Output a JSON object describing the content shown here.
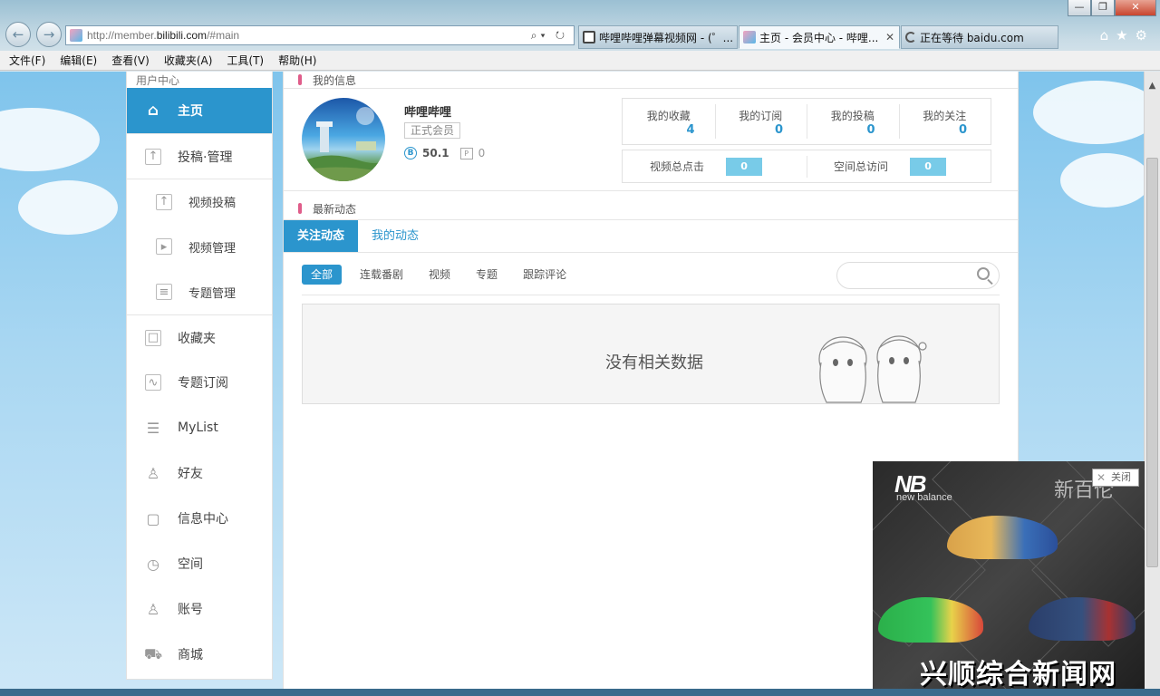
{
  "browser": {
    "address_url_prefix": "http://member.",
    "address_url_domain": "bilibili.com",
    "address_url_path": "/#main",
    "address_tools": "⌕▾ ↻",
    "tabs": [
      {
        "label": "哔哩哔哩弹幕视频网 - (゜...",
        "icon": "tv-icon"
      },
      {
        "label": "主页 - 会员中心 - 哔哩...",
        "icon": "bilibili-icon",
        "close": "✕"
      },
      {
        "label": "正在等待 baidu.com",
        "icon": "loading-icon"
      }
    ],
    "right_tools": "⌂★⚙",
    "window_buttons": [
      "—",
      "❐",
      "✕"
    ],
    "nav_back": "←",
    "nav_forward": "→"
  },
  "menubar": [
    "文件(F)",
    "编辑(E)",
    "查看(V)",
    "收藏夹(A)",
    "工具(T)",
    "帮助(H)"
  ],
  "sidebar": {
    "header": "用户中心",
    "items": [
      {
        "label": "主页",
        "icon": "home-icon",
        "glyph": "⌂"
      },
      {
        "label": "投稿·管理",
        "icon": "upload-icon",
        "glyph": "↑"
      },
      {
        "label": "视频投稿",
        "icon": "upload-icon",
        "glyph": "↑"
      },
      {
        "label": "视频管理",
        "icon": "video-icon",
        "glyph": "▸"
      },
      {
        "label": "专题管理",
        "icon": "list-icon",
        "glyph": "≡"
      },
      {
        "label": "收藏夹",
        "icon": "folder-icon",
        "glyph": "□"
      },
      {
        "label": "专题订阅",
        "icon": "chart-icon",
        "glyph": "∿"
      },
      {
        "label": "MyList",
        "icon": "list-icon",
        "glyph": "☰"
      },
      {
        "label": "好友",
        "icon": "user-icon",
        "glyph": "♙"
      },
      {
        "label": "信息中心",
        "icon": "message-icon",
        "glyph": "▢"
      },
      {
        "label": "空间",
        "icon": "clock-icon",
        "glyph": "◷"
      },
      {
        "label": "账号",
        "icon": "account-icon",
        "glyph": "♙"
      },
      {
        "label": "商城",
        "icon": "cart-icon",
        "glyph": "⛟"
      }
    ]
  },
  "profile": {
    "section_title": "我的信息",
    "username": "哔哩哔哩",
    "badge": "正式会员",
    "coin_icon": "B",
    "coins": "50.1",
    "points_icon": "P",
    "points": "0",
    "stats": [
      {
        "label": "我的收藏",
        "value": "4"
      },
      {
        "label": "我的订阅",
        "value": "0"
      },
      {
        "label": "我的投稿",
        "value": "0"
      },
      {
        "label": "我的关注",
        "value": "0"
      }
    ],
    "stats2": [
      {
        "label": "视频总点击",
        "value": "0"
      },
      {
        "label": "空间总访问",
        "value": "0"
      }
    ]
  },
  "feed": {
    "section_title": "最新动态",
    "tabs": [
      "关注动态",
      "我的动态"
    ],
    "filters": [
      "全部",
      "连载番剧",
      "视频",
      "专题",
      "跟踪评论"
    ],
    "search_placeholder": "",
    "empty_message": "没有相关数据"
  },
  "ad": {
    "brand": "NB",
    "brand_text": "new balance",
    "headline": "新百伦",
    "close_label": "关闭",
    "watermark": "兴顺综合新闻网"
  },
  "colors": {
    "accent": "#2b95cd",
    "section_marker": "#e05d8a",
    "pill": "#78cbe8"
  }
}
